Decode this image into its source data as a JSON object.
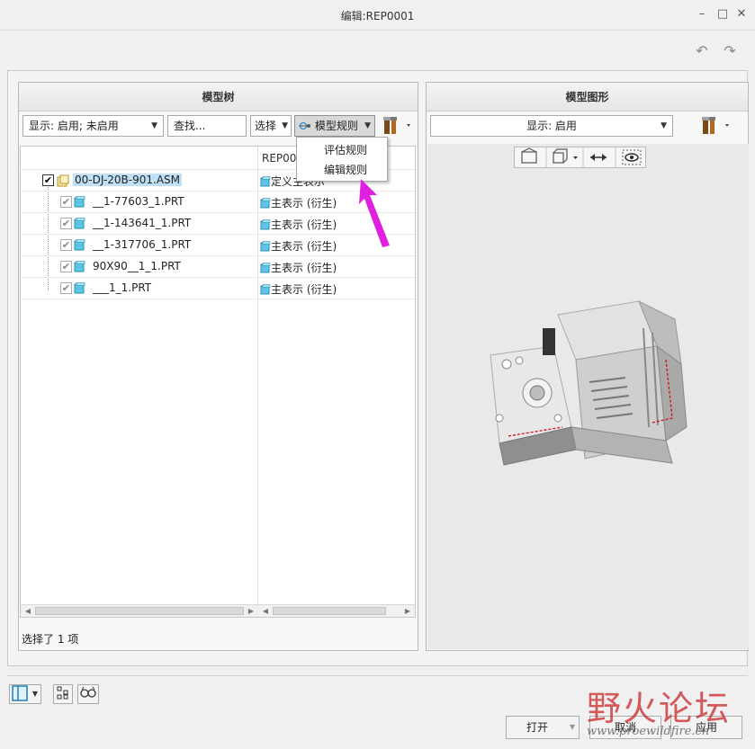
{
  "window": {
    "title": "编辑:REP0001"
  },
  "tree_panel": {
    "title": "模型树",
    "display_combo": "显示: 启用; 未启用",
    "find_field": "查找...",
    "select_button": "选择",
    "rules_button": "模型规则",
    "column2_header": "REP00",
    "status": "选择了 1 项",
    "rows": [
      {
        "name": "00-DJ-20B-901.ASM",
        "rep": "定义主表示"
      },
      {
        "name": "__1-77603_1.PRT",
        "rep": "主表示 (衍生)"
      },
      {
        "name": "__1-143641_1.PRT",
        "rep": "主表示 (衍生)"
      },
      {
        "name": "__1-317706_1.PRT",
        "rep": "主表示 (衍生)"
      },
      {
        "name": "90X90__1_1.PRT",
        "rep": "主表示 (衍生)"
      },
      {
        "name": "___1_1.PRT",
        "rep": "主表示 (衍生)"
      }
    ]
  },
  "rules_menu": {
    "items": [
      "评估规则",
      "编辑规则"
    ]
  },
  "graphics_panel": {
    "title": "模型图形",
    "display_combo": "显示: 启用"
  },
  "footer": {
    "open_button": "打开",
    "cancel_button": "取消",
    "apply_button": "应用"
  },
  "watermark": {
    "brand": "野火论坛",
    "url": "www.proewildfire.cn"
  },
  "colors": {
    "selection": "#bfe0f7",
    "arrow": "#e020e0",
    "accent_cube": "#5bc6e8"
  }
}
